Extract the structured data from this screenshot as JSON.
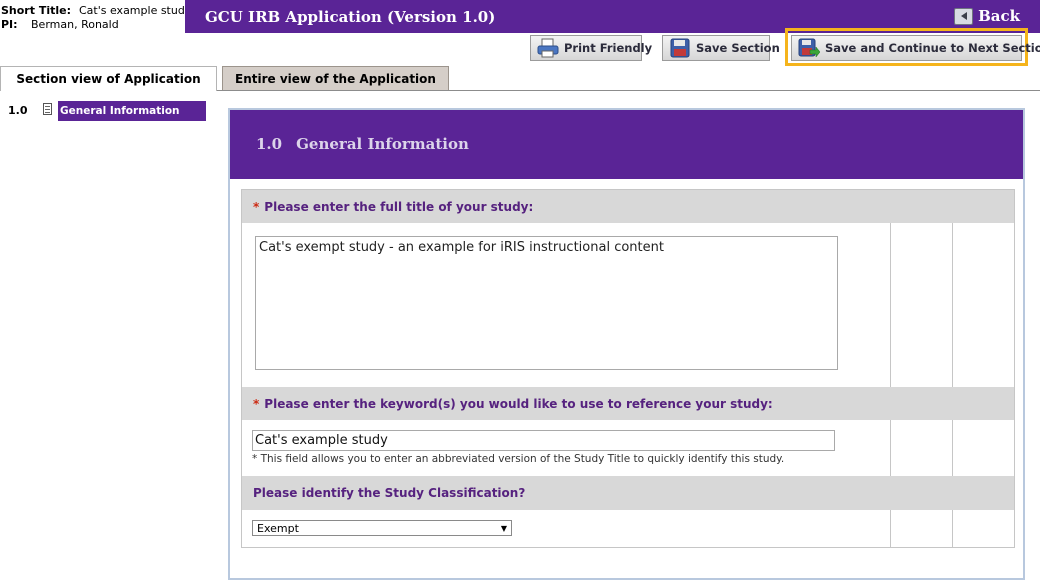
{
  "study": {
    "short_title_label": "Short Title:",
    "short_title": "Cat's example study",
    "pi_label": "PI:",
    "pi_name": "Berman, Ronald"
  },
  "header": {
    "title": "GCU IRB Application (Version 1.0)",
    "back_label": "Back"
  },
  "toolbar": {
    "print_label": "Print Friendly",
    "save_label": "Save Section",
    "save_next_label": "Save and Continue to Next Section"
  },
  "tabs": [
    {
      "label": "Section view of Application",
      "active": true
    },
    {
      "label": "Entire view of the Application",
      "active": false
    }
  ],
  "nav": {
    "number": "1.0",
    "label": "General Information"
  },
  "section": {
    "number": "1.0",
    "title": "General Information"
  },
  "questions": {
    "q1": {
      "required_mark": "*",
      "label": "Please enter the full title of your study:",
      "value": "Cat's exempt study - an example for iRIS instructional content"
    },
    "q2": {
      "required_mark": "*",
      "label": "Please enter the keyword(s) you would like to use to reference your study:",
      "value": "Cat's example study",
      "help": "* This field allows you to enter an abbreviated version of the Study Title to quickly identify this study."
    },
    "q3": {
      "label": "Please identify the Study Classification?",
      "selected": "Exempt"
    }
  },
  "colors": {
    "purple": "#5a2496",
    "highlight": "#f5b41c",
    "required": "#cc2a12",
    "question_text": "#56227f"
  },
  "icons": {
    "back": "back-arrow-icon",
    "print": "printer-icon",
    "save": "floppy-disk-icon",
    "save_next": "save-next-icon",
    "nav_doc": "document-icon"
  }
}
